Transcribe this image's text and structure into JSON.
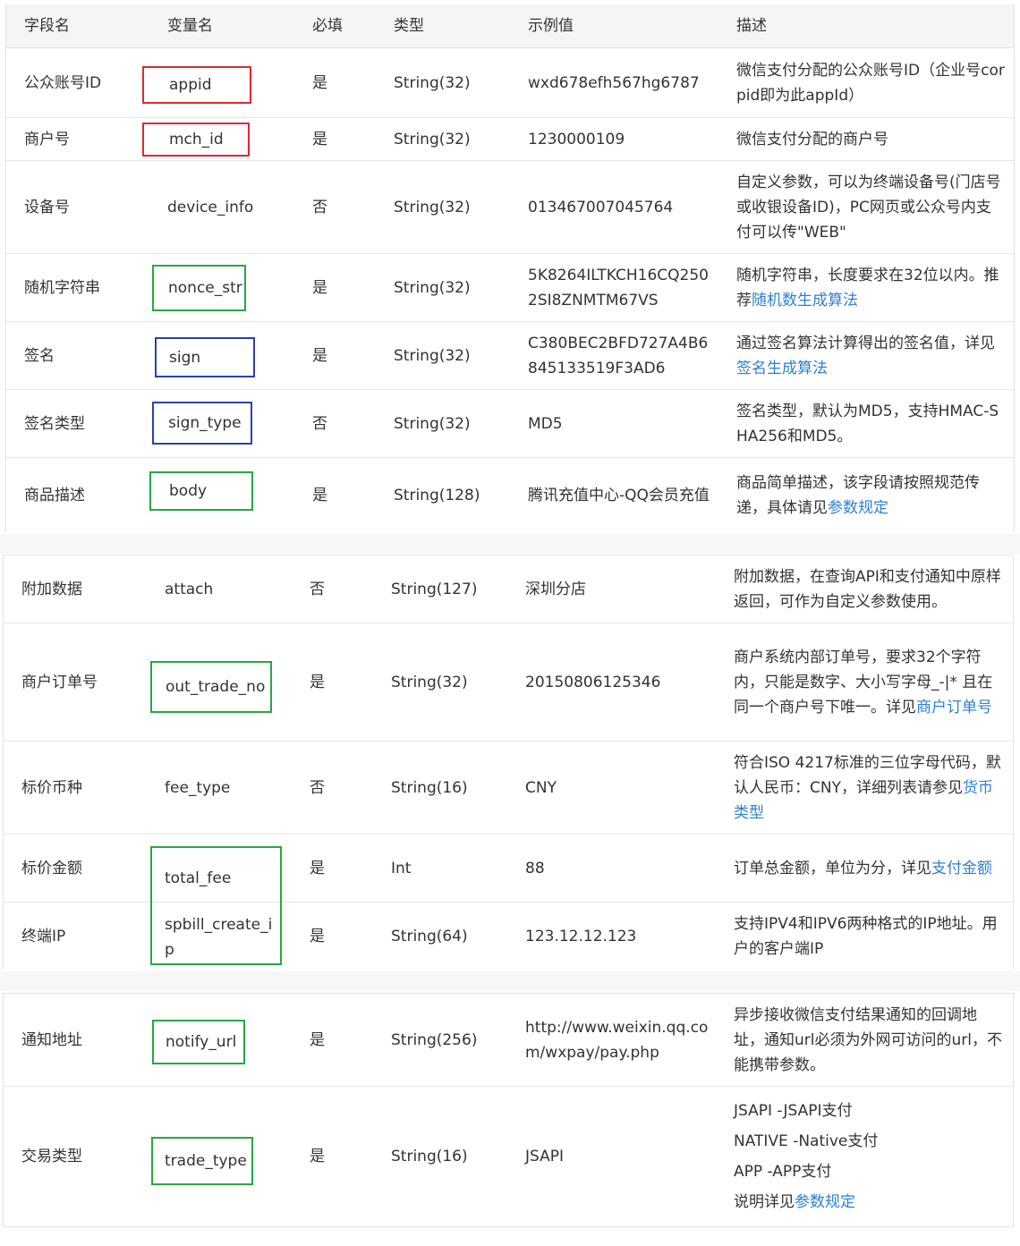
{
  "header": {
    "field": "字段名",
    "var": "变量名",
    "required": "必填",
    "type": "类型",
    "example": "示例值",
    "desc": "描述"
  },
  "rows": [
    {
      "field": "公众账号ID",
      "var": "appid",
      "required": "是",
      "type": "String(32)",
      "example": "wxd678efh567hg6787",
      "desc": "微信支付分配的公众账号ID（企业号corpid即为此appId）"
    },
    {
      "field": "商户号",
      "var": "mch_id",
      "required": "是",
      "type": "String(32)",
      "example": "1230000109",
      "desc": "微信支付分配的商户号"
    },
    {
      "field": "设备号",
      "var": "device_info",
      "required": "否",
      "type": "String(32)",
      "example": "013467007045764",
      "desc": "自定义参数，可以为终端设备号(门店号或收银设备ID)，PC网页或公众号内支付可以传\"WEB\""
    },
    {
      "field": "随机字符串",
      "var": "nonce_str",
      "required": "是",
      "type": "String(32)",
      "example": "5K8264ILTKCH16CQ2502SI8ZNMTM67VS",
      "desc": "随机字符串，长度要求在32位以内。推荐",
      "desc_link": "随机数生成算法"
    },
    {
      "field": "签名",
      "var": "sign",
      "required": "是",
      "type": "String(32)",
      "example": "C380BEC2BFD727A4B6845133519F3AD6",
      "desc": "通过签名算法计算得出的签名值，详见",
      "desc_link": "签名生成算法"
    },
    {
      "field": "签名类型",
      "var": "sign_type",
      "required": "否",
      "type": "String(32)",
      "example": "MD5",
      "desc": "签名类型，默认为MD5，支持HMAC-SHA256和MD5。"
    },
    {
      "field": "商品描述",
      "var": "body",
      "required": "是",
      "type": "String(128)",
      "example": "腾讯充值中心-QQ会员充值",
      "desc": "商品简单描述，该字段请按照规范传递，具体请见",
      "desc_link": "参数规定"
    },
    {
      "field": "附加数据",
      "var": "attach",
      "required": "否",
      "type": "String(127)",
      "example": "深圳分店",
      "desc": "附加数据，在查询API和支付通知中原样返回，可作为自定义参数使用。"
    },
    {
      "field": "商户订单号",
      "var": "out_trade_no",
      "required": "是",
      "type": "String(32)",
      "example": "20150806125346",
      "desc": "商户系统内部订单号，要求32个字符内，只能是数字、大小写字母_-|* 且在同一个商户号下唯一。详见",
      "desc_link": "商户订单号"
    },
    {
      "field": "标价币种",
      "var": "fee_type",
      "required": "否",
      "type": "String(16)",
      "example": "CNY",
      "desc": "符合ISO 4217标准的三位字母代码，默认人民币：CNY，详细列表请参见",
      "desc_link": "货币类型"
    },
    {
      "field": "标价金额",
      "var": "total_fee",
      "required": "是",
      "type": "Int",
      "example": "88",
      "desc": "订单总金额，单位为分，详见",
      "desc_link": "支付金额"
    },
    {
      "field": "终端IP",
      "var": "spbill_create_ip",
      "required": "是",
      "type": "String(64)",
      "example": "123.12.12.123",
      "desc": "支持IPV4和IPV6两种格式的IP地址。用户的客户端IP"
    },
    {
      "field": "通知地址",
      "var": "notify_url",
      "required": "是",
      "type": "String(256)",
      "example": "http://www.weixin.qq.com/wxpay/pay.php",
      "desc": "异步接收微信支付结果通知的回调地址，通知url必须为外网可访问的url，不能携带参数。"
    },
    {
      "field": "交易类型",
      "var": "trade_type",
      "required": "是",
      "type": "String(16)",
      "example": "JSAPI",
      "desc_lines": [
        "JSAPI -JSAPI支付",
        "NATIVE -Native支付",
        "APP -APP支付"
      ],
      "desc": "说明详见",
      "desc_link": "参数规定"
    }
  ],
  "box_colors": {
    "red": "#e0282e",
    "green": "#28a745",
    "blue": "#2b3fb8"
  }
}
